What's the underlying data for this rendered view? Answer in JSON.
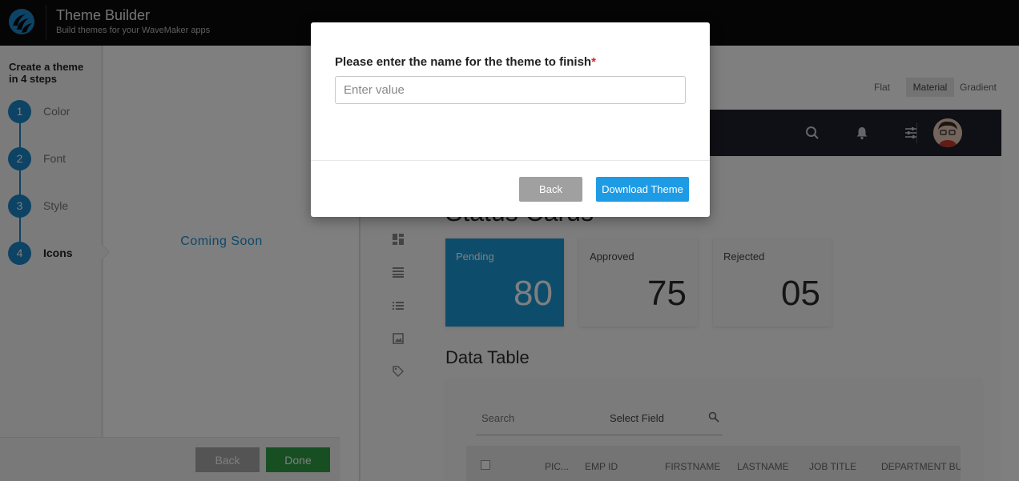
{
  "header": {
    "title": "Theme Builder",
    "subtitle": "Build themes for your WaveMaker apps",
    "logo_icon": "wavemaker-logo-icon"
  },
  "steps_panel": {
    "title": "Create a theme in 4 steps",
    "steps": [
      {
        "number": "1",
        "label": "Color",
        "active": false
      },
      {
        "number": "2",
        "label": "Font",
        "active": false
      },
      {
        "number": "3",
        "label": "Style",
        "active": false
      },
      {
        "number": "4",
        "label": "Icons",
        "active": true
      }
    ]
  },
  "center_panel": {
    "message": "Coming Soon"
  },
  "bottom_bar": {
    "back_label": "Back",
    "done_label": "Done"
  },
  "preview": {
    "style_options": [
      "Flat",
      "Material",
      "Gradient"
    ],
    "selected_style": "Material",
    "header_icons": [
      "search-icon",
      "bell-icon",
      "sliders-icon"
    ],
    "side_icons": [
      "dashboard-icon",
      "table-icon",
      "list-icon",
      "image-icon",
      "tag-icon"
    ],
    "status_cards_title": "Status Cards",
    "cards": [
      {
        "label": "Pending",
        "value": "80"
      },
      {
        "label": "Approved",
        "value": "75"
      },
      {
        "label": "Rejected",
        "value": "05"
      }
    ],
    "data_table": {
      "title": "Data Table",
      "search_placeholder": "Search",
      "select_field": "Select Field",
      "columns": [
        "PIC...",
        "EMP ID",
        "FIRSTNAME",
        "LASTNAME",
        "JOB TITLE",
        "DEPARTMENT BUD"
      ]
    }
  },
  "modal": {
    "label": "Please enter the name for the theme to finish",
    "required_mark": "*",
    "input_placeholder": "Enter value",
    "input_value": "",
    "back_label": "Back",
    "download_label": "Download Theme"
  },
  "colors": {
    "accent": "#1a86c9",
    "done_green": "#2e9e46",
    "download_blue": "#1e9be5",
    "pending_card": "#1a9bd6",
    "app_header": "#1e1f2c"
  }
}
